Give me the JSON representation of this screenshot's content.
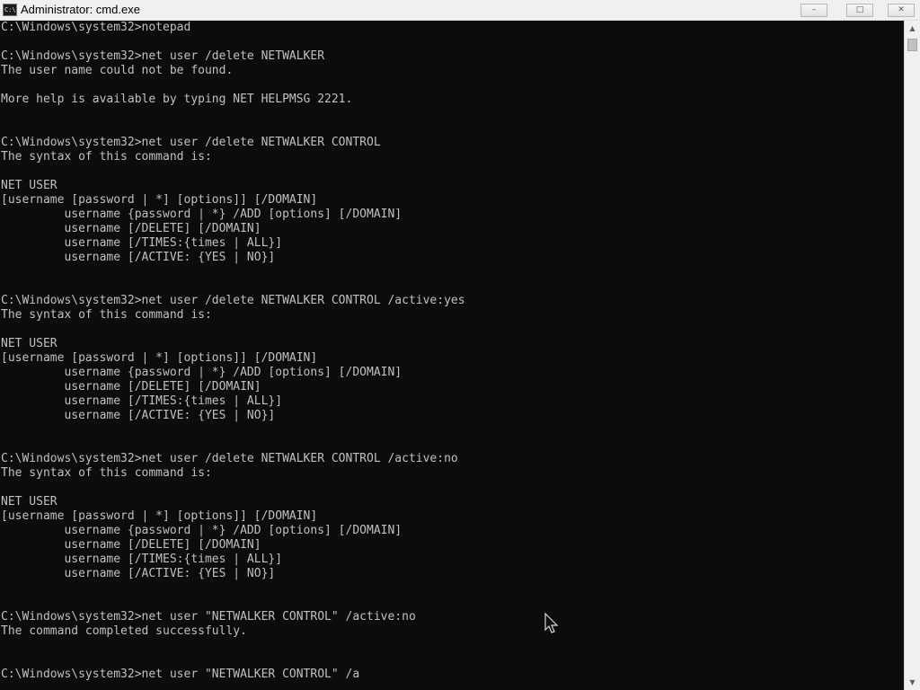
{
  "window": {
    "title": "Administrator: cmd.exe",
    "app_icon": "C:\\",
    "minimize_symbol": "–",
    "maximize_symbol": "□",
    "close_symbol": "✕"
  },
  "scrollbar": {
    "up_arrow": "▲",
    "down_arrow": "▼"
  },
  "console": {
    "lines": [
      "C:\\Windows\\system32>notepad",
      "",
      "C:\\Windows\\system32>net user /delete NETWALKER",
      "The user name could not be found.",
      "",
      "More help is available by typing NET HELPMSG 2221.",
      "",
      "",
      "C:\\Windows\\system32>net user /delete NETWALKER CONTROL",
      "The syntax of this command is:",
      "",
      "NET USER",
      "[username [password | *] [options]] [/DOMAIN]",
      "         username {password | *} /ADD [options] [/DOMAIN]",
      "         username [/DELETE] [/DOMAIN]",
      "         username [/TIMES:{times | ALL}]",
      "         username [/ACTIVE: {YES | NO}]",
      "",
      "",
      "C:\\Windows\\system32>net user /delete NETWALKER CONTROL /active:yes",
      "The syntax of this command is:",
      "",
      "NET USER",
      "[username [password | *] [options]] [/DOMAIN]",
      "         username {password | *} /ADD [options] [/DOMAIN]",
      "         username [/DELETE] [/DOMAIN]",
      "         username [/TIMES:{times | ALL}]",
      "         username [/ACTIVE: {YES | NO}]",
      "",
      "",
      "C:\\Windows\\system32>net user /delete NETWALKER CONTROL /active:no",
      "The syntax of this command is:",
      "",
      "NET USER",
      "[username [password | *] [options]] [/DOMAIN]",
      "         username {password | *} /ADD [options] [/DOMAIN]",
      "         username [/DELETE] [/DOMAIN]",
      "         username [/TIMES:{times | ALL}]",
      "         username [/ACTIVE: {YES | NO}]",
      "",
      "",
      "C:\\Windows\\system32>net user \"NETWALKER CONTROL\" /active:no",
      "The command completed successfully.",
      "",
      "",
      "C:\\Windows\\system32>net user \"NETWALKER CONTROL\" /a"
    ]
  }
}
